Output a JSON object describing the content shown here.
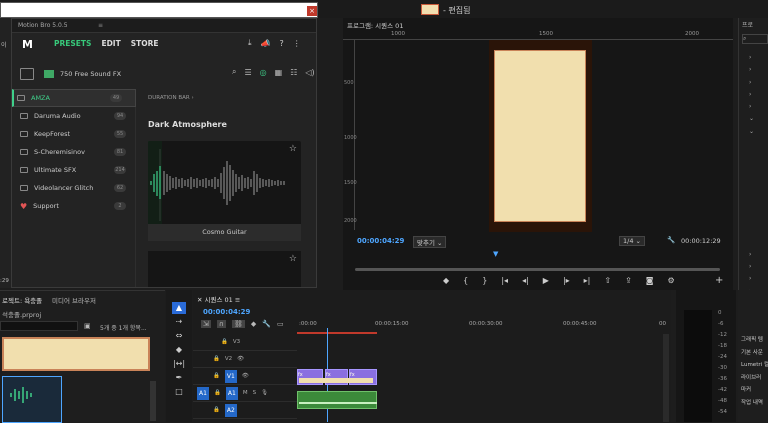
{
  "topbar": {
    "title_suffix": "- 편집됨",
    "close": "×"
  },
  "plugin": {
    "title": "Motion Bro 5.0.5",
    "tabs": [
      "PRESETS",
      "EDIT",
      "STORE"
    ],
    "pack_name": "750 Free Sound FX",
    "sidebar": [
      {
        "label": "AMZA",
        "count": "49"
      },
      {
        "label": "Daruma Audio",
        "count": "94"
      },
      {
        "label": "KeepForest",
        "count": "55"
      },
      {
        "label": "S-Cheremisinov",
        "count": "81"
      },
      {
        "label": "Ultimate SFX",
        "count": "214"
      },
      {
        "label": "Videolancer Glitch",
        "count": "62"
      },
      {
        "label": "Support",
        "count": "2"
      }
    ],
    "breadcrumb": "DURATION BAR",
    "category": "Dark Atmosphere",
    "card_label": "Cosmo Guitar"
  },
  "left_ruler": {
    "label": "이",
    "bottom": ":29"
  },
  "program": {
    "title": "프로그램: 시퀀스 01",
    "ruler_ticks": [
      "1000",
      "1500",
      "2000"
    ],
    "vruler_ticks": [
      "500",
      "1000",
      "1500",
      "2000"
    ],
    "timecode": "00:00:04:29",
    "fit": "맞추기",
    "quality": "1/4",
    "duration": "00:00:12:29"
  },
  "right_top": {
    "label": "프로"
  },
  "project": {
    "tab1": "로젝트: 욕충졸",
    "tab2": "미디어 브라우저",
    "file": "석충졸.prproj",
    "items_label": "5개 중 1개 항목..."
  },
  "sequence": {
    "title": "시퀀스 01",
    "timecode": "00:00:04:29",
    "ruler": [
      ":00:00",
      "00:00:15:00",
      "00:00:30:00",
      "00:00:45:00",
      "00"
    ],
    "tracks": [
      "V3",
      "V2",
      "V1",
      "A1",
      "A2"
    ],
    "clip_fx": "fx"
  },
  "meter": {
    "ticks": [
      "0",
      "-6",
      "-12",
      "-18",
      "-24",
      "-30",
      "-36",
      "-42",
      "-48",
      "-54"
    ]
  },
  "right_list": [
    "그래픽 템",
    "기본 사운",
    "Lumetri 컬",
    "라이브러",
    "마커",
    "작업 내역"
  ]
}
